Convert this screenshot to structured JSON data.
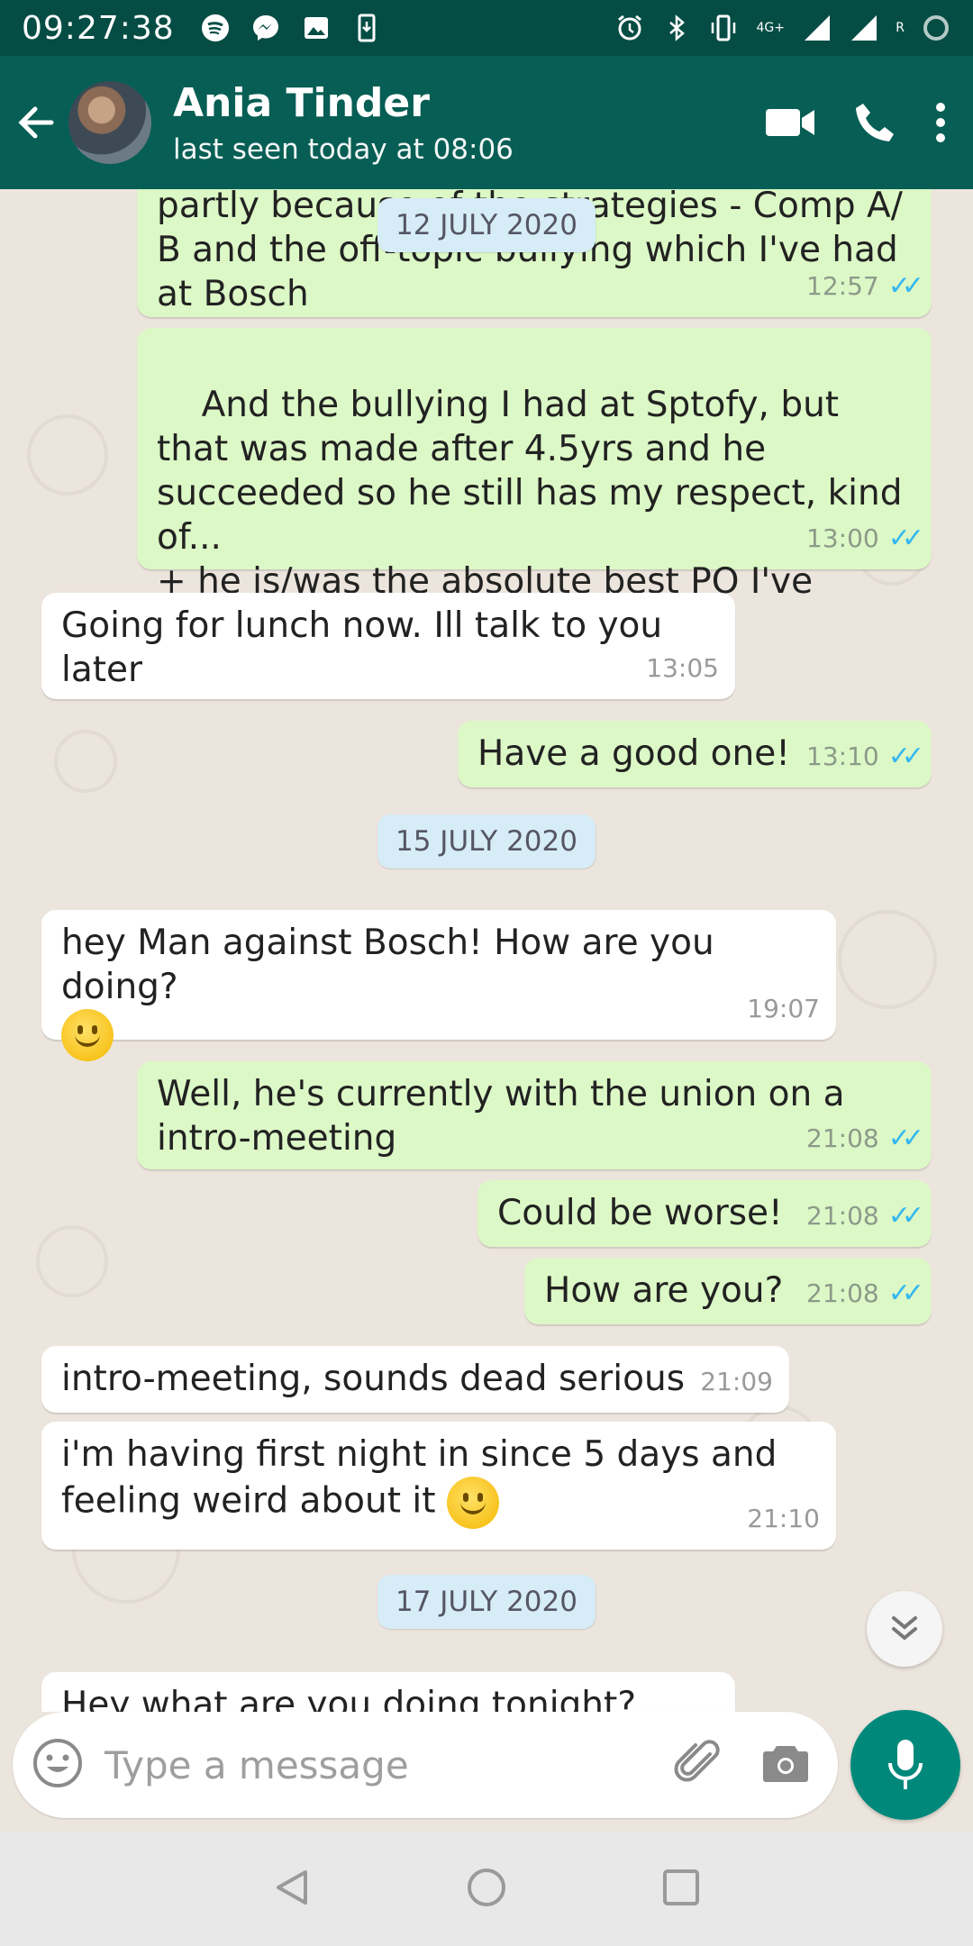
{
  "status_bar": {
    "time": "09:27:38",
    "network_label": "4G+",
    "roaming_label": "R"
  },
  "header": {
    "contact_name": "Ania Tinder",
    "last_seen": "last seen today at 08:06"
  },
  "messages": [
    {
      "type": "out",
      "text": "partly because of the strategies - Comp A/ B and the off-topic bullying which I've had at Bosch",
      "time": "12:57"
    },
    {
      "type": "out",
      "text": "And the bullying I had at Sptofy, but that was made after 4.5yrs and he succeeded so he still has my respect, kind of...\n+ he is/was the absolute best PO I've  ever had, so there is that",
      "time": "13:00"
    },
    {
      "type": "in",
      "text": "Going for lunch now. Ill talk to you later",
      "time": "13:05"
    },
    {
      "type": "out",
      "text": "Have a good one!",
      "time": "13:10"
    },
    {
      "type": "in",
      "text": "hey Man against Bosch! How are you doing?",
      "time": "19:07"
    },
    {
      "type": "out",
      "text": "Well, he's currently with the union on a intro-meeting",
      "time": "21:08"
    },
    {
      "type": "out",
      "text": "Could be worse!",
      "time": "21:08"
    },
    {
      "type": "out",
      "text": "How are you?",
      "time": "21:08"
    },
    {
      "type": "in",
      "text": "intro-meeting, sounds dead serious",
      "time": "21:09"
    },
    {
      "type": "in",
      "text": "i'm having first night in since 5 days and feeling weird about it",
      "time": "21:10"
    },
    {
      "type": "in",
      "text": "Hey what are you doing tonight?",
      "time": ""
    }
  ],
  "date_chips": [
    "12 JULY 2020",
    "15 JULY 2020",
    "17 JULY 2020"
  ],
  "composer": {
    "placeholder": "Type a message"
  },
  "colors": {
    "header": "#075e54",
    "status_bar": "#054d44",
    "outgoing_bubble": "#dcf8c6",
    "incoming_bubble": "#ffffff",
    "read_ticks": "#34b7f1",
    "mic_button": "#00897b"
  }
}
